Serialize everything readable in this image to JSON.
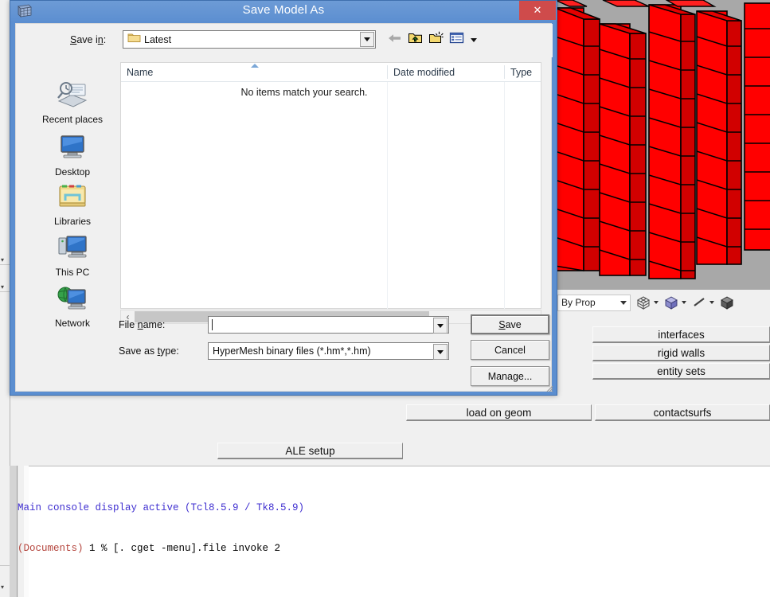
{
  "dialog": {
    "title": "Save Model As",
    "window_icon": "grid-window-icon",
    "close_label": "✕",
    "save_in": {
      "label": "Save in:",
      "value": "Latest",
      "folder_icon": "folder-icon",
      "dropdown_icon": "chevron-down-icon"
    },
    "nav_icons": [
      {
        "name": "back-arrow-icon",
        "label": "Back"
      },
      {
        "name": "up-folder-icon",
        "label": "Up one level"
      },
      {
        "name": "new-folder-icon",
        "label": "Create New Folder"
      },
      {
        "name": "views-icon",
        "label": "Views"
      }
    ],
    "places": [
      {
        "label": "Recent places",
        "icon": "recent-places-icon"
      },
      {
        "label": "Desktop",
        "icon": "desktop-icon"
      },
      {
        "label": "Libraries",
        "icon": "libraries-icon"
      },
      {
        "label": "This PC",
        "icon": "this-pc-icon"
      },
      {
        "label": "Network",
        "icon": "network-icon"
      }
    ],
    "file_list": {
      "columns": [
        "Name",
        "Date modified",
        "Type"
      ],
      "empty_message": "No items match your search.",
      "sort_column": "Name",
      "sort_direction": "ascending",
      "rows": []
    },
    "hscroll": {
      "left_arrow": "‹",
      "right_arrow": "›",
      "thumb_percent": 75
    },
    "file_name": {
      "label": "File name:",
      "value": "",
      "placeholder": ""
    },
    "save_as_type": {
      "label": "Save as type:",
      "value": "HyperMesh binary files (*.hm*,*.hm)"
    },
    "buttons": {
      "save": "Save",
      "cancel": "Cancel",
      "manage": "Manage..."
    }
  },
  "app": {
    "toolbar": {
      "display_mode": "By Prop",
      "icons": [
        {
          "name": "wireframe-cube-icon"
        },
        {
          "name": "shaded-cube-icon"
        },
        {
          "name": "line-icon"
        },
        {
          "name": "solid-cube-icon"
        }
      ]
    },
    "panel_buttons": [
      {
        "label": "interfaces",
        "name": "interfaces-button"
      },
      {
        "label": "rigid walls",
        "name": "rigid-walls-button"
      },
      {
        "label": "entity sets",
        "name": "entity-sets-button"
      },
      {
        "label": "load on geom",
        "name": "load-on-geom-button"
      },
      {
        "label": "contactsurfs",
        "name": "contactsurfs-button"
      },
      {
        "label": "ALE setup",
        "name": "ale-setup-button"
      }
    ],
    "console": {
      "line1": "Main console display active (Tcl8.5.9 / Tk8.5.9)",
      "line2_prompt": "(Documents)",
      "line2_rest": " 1 % [. cget -menu].file invoke 2"
    },
    "viewport": {
      "description": "3D finite element mesh of red columns",
      "background_color": "#a8a8a8",
      "mesh_color": "#ff0000",
      "edge_color": "#000000"
    }
  },
  "colors": {
    "title_bar": "#5b8ed0",
    "close_button": "#cf4b4b",
    "dialog_face": "#f0f0f0",
    "console_blue": "#3f2fd0",
    "console_red": "#b4443c"
  }
}
